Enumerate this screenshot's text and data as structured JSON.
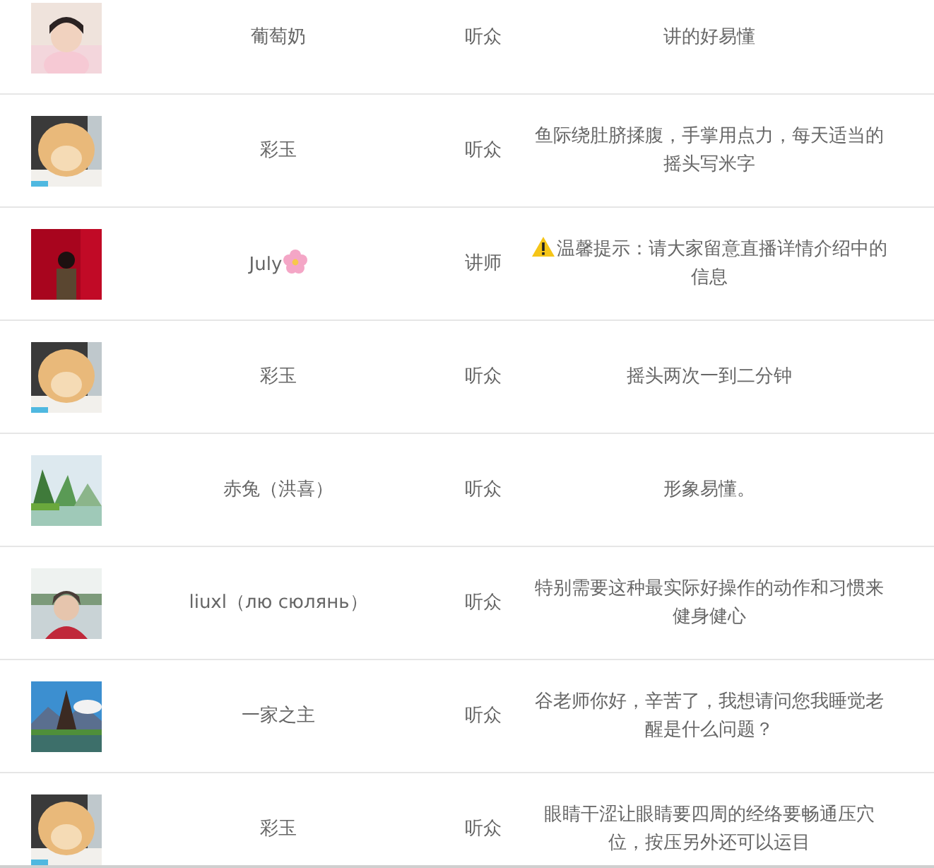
{
  "rows": [
    {
      "name": "葡萄奶",
      "flower": false,
      "role": "听众",
      "warning": false,
      "comment": "讲的好易懂"
    },
    {
      "name": "彩玉",
      "flower": false,
      "role": "听众",
      "warning": false,
      "comment": "鱼际绕肚脐揉腹，手掌用点力，每天适当的摇头写米字"
    },
    {
      "name": "July",
      "flower": true,
      "role": "讲师",
      "warning": true,
      "comment": "温馨提示：请大家留意直播详情介绍中的信息"
    },
    {
      "name": "彩玉",
      "flower": false,
      "role": "听众",
      "warning": false,
      "comment": "摇头两次一到二分钟"
    },
    {
      "name": "赤兔（洪喜）",
      "flower": false,
      "role": "听众",
      "warning": false,
      "comment": "形象易懂。"
    },
    {
      "name": "liuxl（лю сюлянь）",
      "flower": false,
      "role": "听众",
      "warning": false,
      "comment": "特别需要这种最实际好操作的动作和习惯来健身健心"
    },
    {
      "name": "一家之主",
      "flower": false,
      "role": "听众",
      "warning": false,
      "comment": "谷老师你好，辛苦了，我想请问您我睡觉老醒是什么问题？"
    },
    {
      "name": "彩玉",
      "flower": false,
      "role": "听众",
      "warning": false,
      "comment": "眼睛干涩让眼睛要四周的经络要畅通压穴位，按压另外还可以运目"
    }
  ]
}
